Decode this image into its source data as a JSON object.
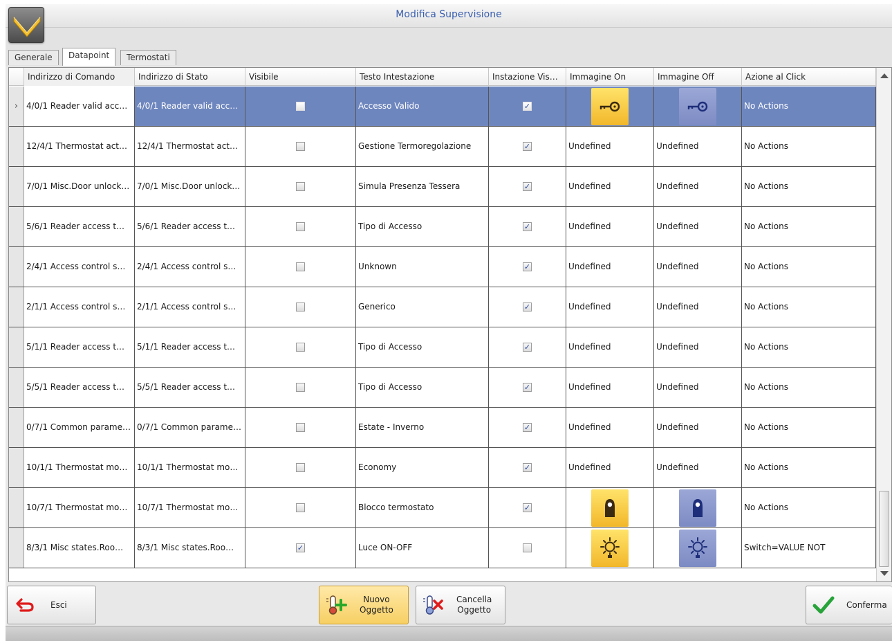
{
  "window": {
    "title": "Modifica Supervisione"
  },
  "tabs": [
    {
      "label": "Generale",
      "active": false
    },
    {
      "label": "Datapoint",
      "active": true
    },
    {
      "label": "Termostati",
      "active": false
    }
  ],
  "grid": {
    "columns": [
      "Indirizzo di Comando",
      "Indirizzo di Stato",
      "Visibile",
      "Testo Intestazione",
      "Instazione Vis…",
      "Immagine On",
      "Immagine Off",
      "Azione al Click"
    ],
    "rows": [
      {
        "cmd": "4/0/1 Reader valid acc…",
        "state": "4/0/1 Reader valid acc…",
        "visible": false,
        "header": "Accesso Valido",
        "inst": true,
        "img_on": "key-icon",
        "img_off": "key-icon",
        "on_text": "",
        "off_text": "",
        "action": "No Actions"
      },
      {
        "cmd": "12/4/1 Thermostat act…",
        "state": "12/4/1 Thermostat act…",
        "visible": false,
        "header": "Gestione Termoregolazione",
        "inst": true,
        "img_on": "",
        "img_off": "",
        "on_text": "Undefined",
        "off_text": "Undefined",
        "action": "No Actions"
      },
      {
        "cmd": "7/0/1 Misc.Door unlock…",
        "state": "7/0/1 Misc.Door unlock…",
        "visible": false,
        "header": "Simula Presenza Tessera",
        "inst": true,
        "img_on": "",
        "img_off": "",
        "on_text": "Undefined",
        "off_text": "Undefined",
        "action": "No Actions"
      },
      {
        "cmd": "5/6/1 Reader access t…",
        "state": "5/6/1 Reader access t…",
        "visible": false,
        "header": "Tipo di Accesso",
        "inst": true,
        "img_on": "",
        "img_off": "",
        "on_text": "Undefined",
        "off_text": "Undefined",
        "action": "No Actions"
      },
      {
        "cmd": "2/4/1 Access control s…",
        "state": "2/4/1 Access control s…",
        "visible": false,
        "header": "Unknown",
        "inst": true,
        "img_on": "",
        "img_off": "",
        "on_text": "Undefined",
        "off_text": "Undefined",
        "action": "No Actions"
      },
      {
        "cmd": "2/1/1 Access control s…",
        "state": "2/1/1 Access control s…",
        "visible": false,
        "header": "Generico",
        "inst": true,
        "img_on": "",
        "img_off": "",
        "on_text": "Undefined",
        "off_text": "Undefined",
        "action": "No Actions"
      },
      {
        "cmd": "5/1/1 Reader access t…",
        "state": "5/1/1 Reader access t…",
        "visible": false,
        "header": "Tipo di Accesso",
        "inst": true,
        "img_on": "",
        "img_off": "",
        "on_text": "Undefined",
        "off_text": "Undefined",
        "action": "No Actions"
      },
      {
        "cmd": "5/5/1 Reader access t…",
        "state": "5/5/1 Reader access t…",
        "visible": false,
        "header": "Tipo di Accesso",
        "inst": true,
        "img_on": "",
        "img_off": "",
        "on_text": "Undefined",
        "off_text": "Undefined",
        "action": "No Actions"
      },
      {
        "cmd": "0/7/1 Common parame…",
        "state": "0/7/1 Common parame…",
        "visible": false,
        "header": "Estate - Inverno",
        "inst": true,
        "img_on": "",
        "img_off": "",
        "on_text": "Undefined",
        "off_text": "Undefined",
        "action": "No Actions"
      },
      {
        "cmd": "10/1/1 Thermostat mo…",
        "state": "10/1/1 Thermostat mo…",
        "visible": false,
        "header": "Economy",
        "inst": true,
        "img_on": "",
        "img_off": "",
        "on_text": "Undefined",
        "off_text": "Undefined",
        "action": "No Actions"
      },
      {
        "cmd": "10/7/1 Thermostat mo…",
        "state": "10/7/1 Thermostat mo…",
        "visible": false,
        "header": "Blocco termostato",
        "inst": true,
        "img_on": "door-hanger-icon",
        "img_off": "door-hanger-icon",
        "on_text": "",
        "off_text": "",
        "action": "No Actions"
      },
      {
        "cmd": "8/3/1 Misc states.Roo…",
        "state": "8/3/1 Misc states.Roo…",
        "visible": true,
        "header": "Luce ON-OFF",
        "inst": false,
        "img_on": "light-bulb-icon",
        "img_off": "light-bulb-icon",
        "on_text": "",
        "off_text": "",
        "action": "Switch=VALUE NOT"
      }
    ]
  },
  "buttons": {
    "exit": "Esci",
    "new_line1": "Nuovo",
    "new_line2": "Oggetto",
    "delete_line1": "Cancella",
    "delete_line2": "Oggetto",
    "confirm": "Conferma"
  },
  "colors": {
    "selected_row": "#6e86be",
    "title_text": "#3b5fb0",
    "image_on_bg": "#f2b72a",
    "image_off_bg": "#7d8bc4"
  }
}
